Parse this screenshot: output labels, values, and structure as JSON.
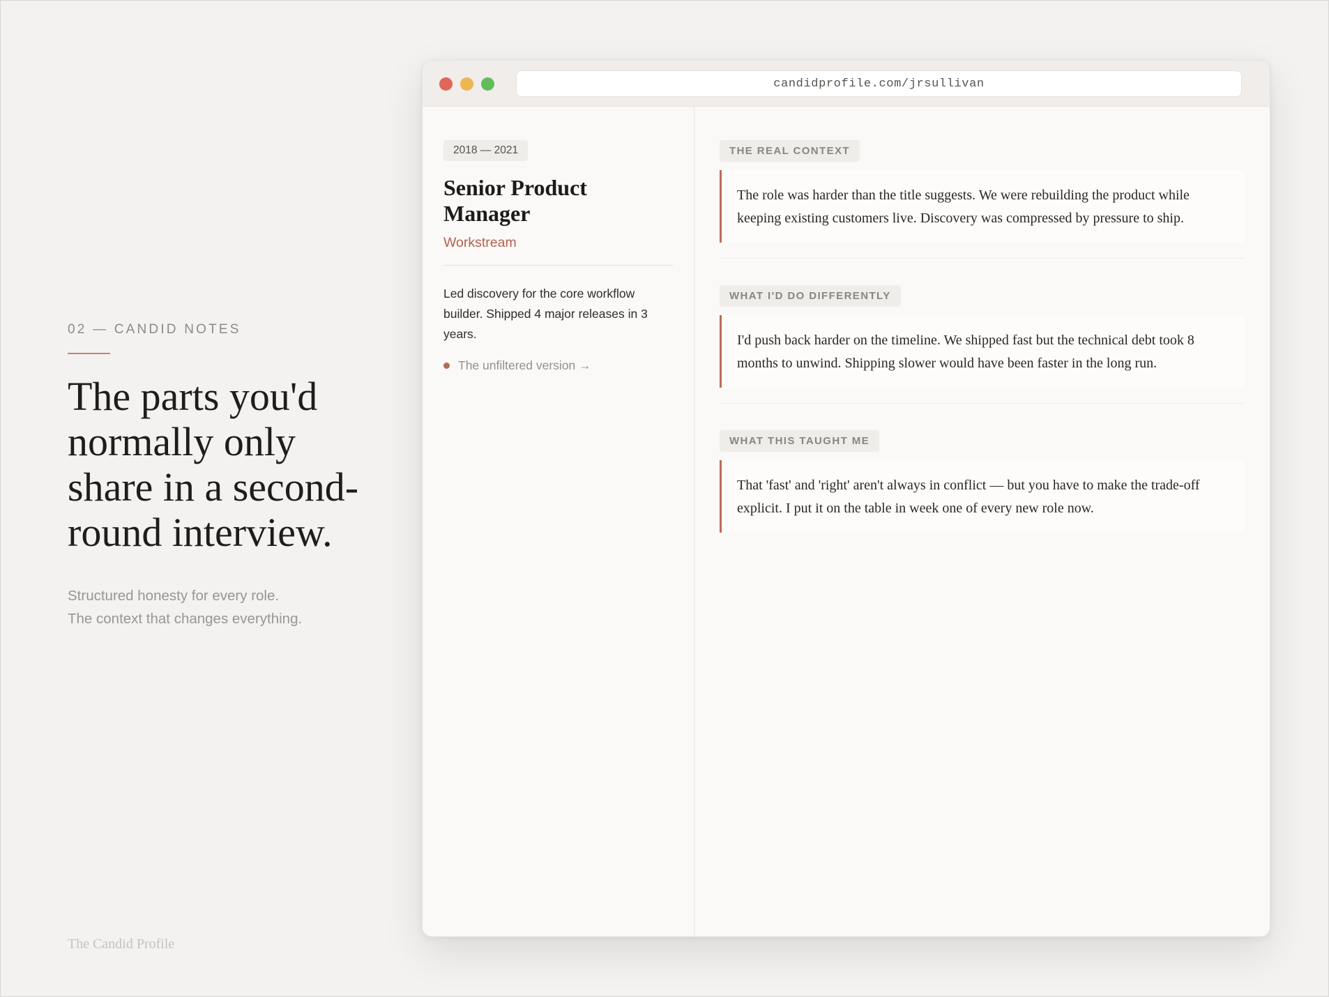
{
  "hero": {
    "eyebrow": "02 — CANDID NOTES",
    "headline": "The parts you'd normally only share in a second-round interview.",
    "sub_line_1": "Structured honesty for every role.",
    "sub_line_2": "The context that changes everything.",
    "brand": "The Candid Profile"
  },
  "browser": {
    "url": "candidprofile.com/jrsullivan"
  },
  "role": {
    "dates": "2018 — 2021",
    "title": "Senior Product Manager",
    "company": "Workstream",
    "description": "Led discovery for the core workflow builder. Shipped 4 major releases in 3 years.",
    "link_label": "The unfiltered version →"
  },
  "notes": [
    {
      "tag": "THE REAL CONTEXT",
      "body": "The role was harder than the title suggests. We were rebuilding the product while keeping existing customers live. Discovery was compressed by pressure to ship."
    },
    {
      "tag": "WHAT I'D DO DIFFERENTLY",
      "body": "I'd push back harder on the timeline. We shipped fast but the technical debt took 8 months to unwind. Shipping slower would have been faster in the long run."
    },
    {
      "tag": "WHAT THIS TAUGHT ME",
      "body": "That 'fast' and 'right' aren't always in conflict — but you have to make the trade-off explicit. I put it on the table in week one of every new role now."
    }
  ],
  "colors": {
    "accent": "#b5614f",
    "rule_accent": "#bd6a58",
    "dot_red": "#e0665a",
    "dot_yellow": "#edb651",
    "dot_green": "#63bc5a"
  }
}
